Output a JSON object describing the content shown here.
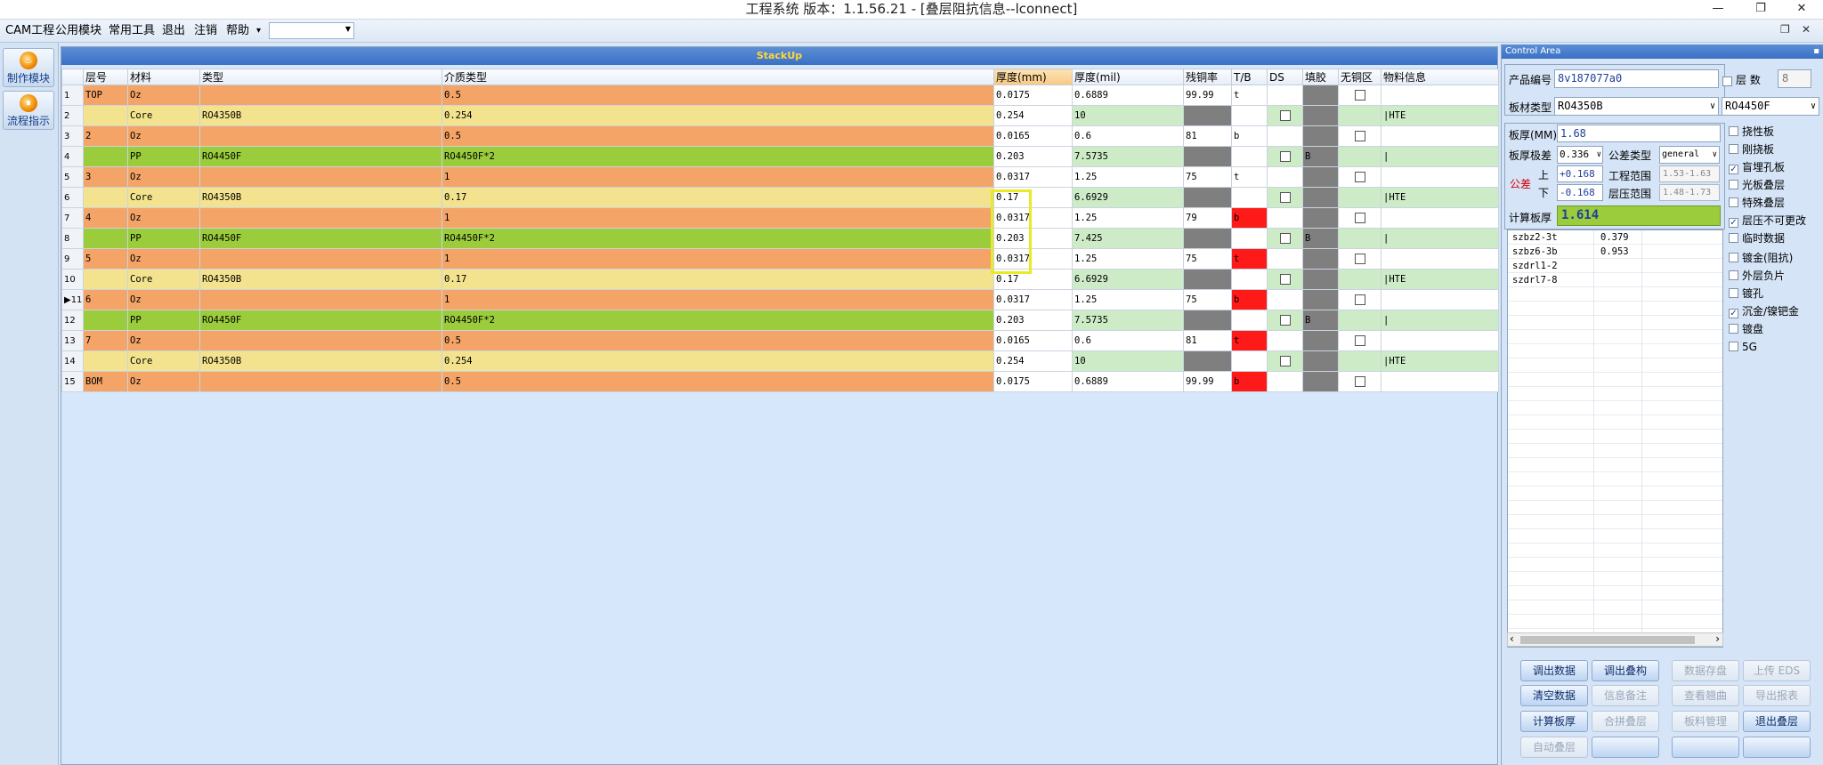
{
  "window": {
    "title": "工程系统   版本：1.1.56.21 - [叠层阻抗信息--lconnect]",
    "minimize": "—",
    "restore": "❐",
    "close": "✕"
  },
  "menu": {
    "items": [
      "CAM工程",
      "公用模块",
      "常用工具",
      "退出",
      "注销",
      "帮助"
    ],
    "help_arrow": "▾",
    "combo_value": ""
  },
  "left_toolbar": {
    "buttons": [
      {
        "label": "制作模块",
        "icon": "flame-icon",
        "glyph": "♨"
      },
      {
        "label": "流程指示",
        "icon": "pause-circle-icon",
        "glyph": "⏸"
      }
    ]
  },
  "stackup": {
    "title": "StackUp",
    "columns": [
      "层号",
      "材料",
      "类型",
      "介质类型",
      "厚度(mm)",
      "厚度(mil)",
      "残铜率",
      "T/B",
      "DS",
      "填胶",
      "无铜区",
      "物料信息"
    ],
    "rows": [
      {
        "n": "1",
        "layer": "TOP",
        "mat": "Oz",
        "type": "",
        "diel": "0.5",
        "mm": "0.0175",
        "mil": "0.6889",
        "cu": "99.99",
        "tb": "t",
        "ds": "",
        "fill": "",
        "info": "",
        "kind": "cu"
      },
      {
        "n": "2",
        "layer": "",
        "mat": "Core",
        "type": "RO4350B",
        "diel": "0.254",
        "mm": "0.254",
        "mil": "10",
        "cu": "",
        "tb": "",
        "ds": "",
        "fill": "",
        "info": "|HTE",
        "kind": "core"
      },
      {
        "n": "3",
        "layer": "2",
        "mat": "Oz",
        "type": "",
        "diel": "0.5",
        "mm": "0.0165",
        "mil": "0.6",
        "cu": "81",
        "tb": "b",
        "ds": "",
        "fill": "",
        "info": "",
        "kind": "cu"
      },
      {
        "n": "4",
        "layer": "",
        "mat": "PP",
        "type": "RO4450F",
        "diel": "RO4450F*2",
        "mm": "0.203",
        "mil": "7.5735",
        "cu": "",
        "tb": "",
        "ds": "",
        "fill": "B",
        "info": "|",
        "kind": "pp"
      },
      {
        "n": "5",
        "layer": "3",
        "mat": "Oz",
        "type": "",
        "diel": "1",
        "mm": "0.0317",
        "mil": "1.25",
        "cu": "75",
        "tb": "t",
        "ds": "",
        "fill": "",
        "info": "",
        "kind": "cu"
      },
      {
        "n": "6",
        "layer": "",
        "mat": "Core",
        "type": "RO4350B",
        "diel": "0.17",
        "mm": "0.17",
        "mil": "6.6929",
        "cu": "",
        "tb": "",
        "ds": "",
        "fill": "",
        "info": "|HTE",
        "kind": "core"
      },
      {
        "n": "7",
        "layer": "4",
        "mat": "Oz",
        "type": "",
        "diel": "1",
        "mm": "0.0317",
        "mil": "1.25",
        "cu": "79",
        "tb": "b",
        "ds": "",
        "fill": "",
        "info": "",
        "kind": "cu"
      },
      {
        "n": "8",
        "layer": "",
        "mat": "PP",
        "type": "RO4450F",
        "diel": "RO4450F*2",
        "mm": "0.203",
        "mil": "7.425",
        "cu": "",
        "tb": "",
        "ds": "",
        "fill": "B",
        "info": "|",
        "kind": "pp"
      },
      {
        "n": "9",
        "layer": "5",
        "mat": "Oz",
        "type": "",
        "diel": "1",
        "mm": "0.0317",
        "mil": "1.25",
        "cu": "75",
        "tb": "t",
        "ds": "",
        "fill": "",
        "info": "",
        "kind": "cu"
      },
      {
        "n": "10",
        "layer": "",
        "mat": "Core",
        "type": "RO4350B",
        "diel": "0.17",
        "mm": "0.17",
        "mil": "6.6929",
        "cu": "",
        "tb": "",
        "ds": "",
        "fill": "",
        "info": "|HTE",
        "kind": "core"
      },
      {
        "n": "▶11",
        "layer": "6",
        "mat": "Oz",
        "type": "",
        "diel": "1",
        "mm": "0.0317",
        "mil": "1.25",
        "cu": "75",
        "tb": "b",
        "ds": "",
        "fill": "",
        "info": "",
        "kind": "cu"
      },
      {
        "n": "12",
        "layer": "",
        "mat": "PP",
        "type": "RO4450F",
        "diel": "RO4450F*2",
        "mm": "0.203",
        "mil": "7.5735",
        "cu": "",
        "tb": "",
        "ds": "",
        "fill": "B",
        "info": "|",
        "kind": "pp"
      },
      {
        "n": "13",
        "layer": "7",
        "mat": "Oz",
        "type": "",
        "diel": "0.5",
        "mm": "0.0165",
        "mil": "0.6",
        "cu": "81",
        "tb": "t",
        "ds": "",
        "fill": "",
        "info": "",
        "kind": "cu"
      },
      {
        "n": "14",
        "layer": "",
        "mat": "Core",
        "type": "RO4350B",
        "diel": "0.254",
        "mm": "0.254",
        "mil": "10",
        "cu": "",
        "tb": "",
        "ds": "",
        "fill": "",
        "info": "|HTE",
        "kind": "core"
      },
      {
        "n": "15",
        "layer": "BOM",
        "mat": "Oz",
        "type": "",
        "diel": "0.5",
        "mm": "0.0175",
        "mil": "0.6889",
        "cu": "99.99",
        "tb": "b",
        "ds": "",
        "fill": "",
        "info": "",
        "kind": "cu"
      }
    ]
  },
  "control": {
    "title": "Control Area",
    "pin": "📌",
    "product_label": "产品编号",
    "product_value": "8v187077a0",
    "layers_label": "层  数",
    "layers_value": "8",
    "board_type_label": "板材类型",
    "board_type_value": "RO4350B",
    "board_type2_value": "RO4450F",
    "thickness_label": "板厚(MM)",
    "thickness_value": "1.68",
    "extreme_label": "板厚极差",
    "extreme_value": "0.336",
    "tol_type_label": "公差类型",
    "tol_type_value": "general",
    "tol_label": "公差",
    "upper_label": "上",
    "lower_label": "下",
    "upper_value": "+0.168",
    "lower_value": "-0.168",
    "eng_range_label": "工程范围",
    "eng_range_value": "1.53-1.63",
    "press_range_label": "层压范围",
    "press_range_value": "1.48-1.73",
    "calc_label": "计算板厚",
    "calc_value": "1.614",
    "checks": [
      {
        "label": "挠性板",
        "checked": false,
        "on": "",
        "off": ""
      },
      {
        "label": "刚挠板",
        "checked": false,
        "on": "",
        "off": ""
      },
      {
        "label": "盲埋孔板",
        "checked": true,
        "on": "✓",
        "off": ""
      },
      {
        "label": "光板叠层",
        "checked": false,
        "on": "",
        "off": ""
      },
      {
        "label": "特殊叠层",
        "checked": false,
        "on": "",
        "off": ""
      },
      {
        "label": "层压不可更改",
        "checked": true,
        "on": "✓",
        "off": ""
      },
      {
        "label": "临时数据",
        "checked": false,
        "on": "",
        "off": ""
      },
      {
        "label": "镀金(阻抗)",
        "checked": false,
        "on": "",
        "off": ""
      },
      {
        "label": "外层负片",
        "checked": false,
        "on": "",
        "off": ""
      },
      {
        "label": "镀孔",
        "checked": false,
        "on": "",
        "off": ""
      },
      {
        "label": "沉金/镍钯金",
        "checked": true,
        "on": "✓",
        "off": ""
      },
      {
        "label": "镀盘",
        "checked": false,
        "on": "",
        "off": ""
      },
      {
        "label": "5G",
        "checked": false,
        "on": "",
        "off": ""
      }
    ],
    "results": [
      {
        "name": "szbz2-3t",
        "value": "0.379"
      },
      {
        "name": "szbz6-3b",
        "value": "0.953"
      },
      {
        "name": "szdrl1-2",
        "value": ""
      },
      {
        "name": "szdrl7-8",
        "value": ""
      }
    ],
    "scroll_left": "‹",
    "scroll_right": "›",
    "buttons": [
      {
        "label": "调出数据",
        "enabled": true
      },
      {
        "label": "调出叠构",
        "enabled": true
      },
      {
        "label": "数据存盘",
        "enabled": false
      },
      {
        "label": "上传 EDS",
        "enabled": false
      },
      {
        "label": "清空数据",
        "enabled": true
      },
      {
        "label": "信息备注",
        "enabled": false
      },
      {
        "label": "查看翘曲",
        "enabled": false
      },
      {
        "label": "导出报表",
        "enabled": false
      },
      {
        "label": "计算板厚",
        "enabled": true
      },
      {
        "label": "合拼叠层",
        "enabled": false
      },
      {
        "label": "板料管理",
        "enabled": false
      },
      {
        "label": "退出叠层",
        "enabled": true
      },
      {
        "label": "自动叠层",
        "enabled": false
      },
      {
        "label": "",
        "enabled": true
      },
      {
        "label": "",
        "enabled": true
      },
      {
        "label": "",
        "enabled": true
      }
    ]
  }
}
